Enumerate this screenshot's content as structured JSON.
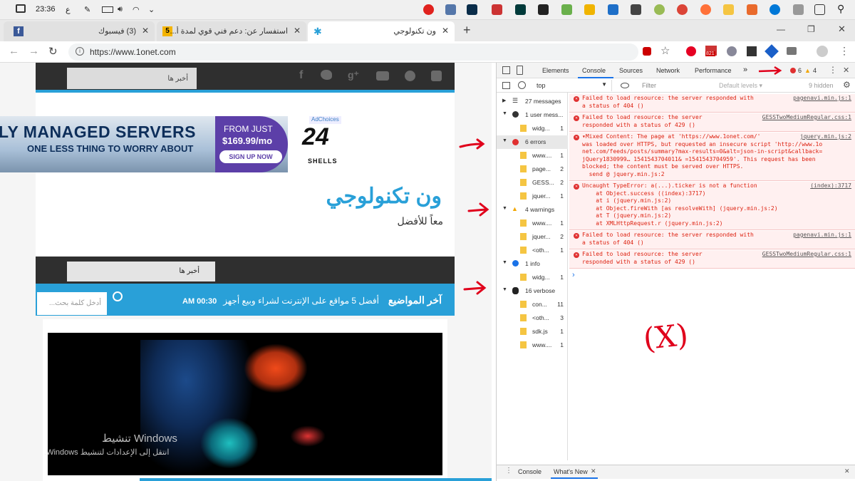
{
  "taskbar": {
    "time": "23:36",
    "lang": "ع"
  },
  "tabs": [
    {
      "title": "(3) فيسبوك",
      "icon": "facebook-icon"
    },
    {
      "title": "استفسار عن: دعم فني قوي لمدة أ...",
      "icon": "forum-icon"
    },
    {
      "title": "ون تكنولوجي",
      "icon": "site-icon"
    }
  ],
  "address": {
    "url": "https://www.1onet.com",
    "ext_badge": "821"
  },
  "site": {
    "search_placeholder_top": "أخبر ها",
    "ad": {
      "headline": "LY MANAGED SERVERS",
      "subline": "ONE LESS THING TO WORRY ABOUT",
      "from": "FROM JUST",
      "price": "$169.99/mo",
      "cta": "SIGN UP NOW",
      "adchoices": "AdChoices",
      "brand_num": "24",
      "brand_name": "SHELLS"
    },
    "title": "ون تكنولوجي",
    "tagline": "معاً للأفضل",
    "search_placeholder_mid": "أخبر ها",
    "ticker_label": "آخر المواضيع",
    "ticker_text": "أفضل 5 مواقع على الإنترنت لشراء وبيع أجهز",
    "ticker_time": "AM 00:30",
    "search_input": "أدخل كلمة بحث...",
    "watermark1": "تنشيط Windows",
    "watermark2": "انتقل إلى الإعدادات لتنشيط Windows."
  },
  "devtools": {
    "tabs": [
      "Elements",
      "Console",
      "Sources",
      "Network",
      "Performance",
      "»"
    ],
    "error_count": "6",
    "warning_count": "4",
    "context": "top",
    "filter_placeholder": "Filter",
    "levels": "Default levels ▾",
    "hidden": "9 hidden",
    "sidebar": [
      {
        "label": "27 messages",
        "count": "",
        "kind": "list"
      },
      {
        "label": "1 user mess...",
        "count": "",
        "kind": "user"
      },
      {
        "label": "widg...",
        "count": "1",
        "kind": "file"
      },
      {
        "label": "6 errors",
        "count": "",
        "kind": "error"
      },
      {
        "label": "www....",
        "count": "1",
        "kind": "file"
      },
      {
        "label": "page...",
        "count": "2",
        "kind": "file"
      },
      {
        "label": "GESS...",
        "count": "2",
        "kind": "file"
      },
      {
        "label": "jquer...",
        "count": "1",
        "kind": "file"
      },
      {
        "label": "4 warnings",
        "count": "",
        "kind": "warning"
      },
      {
        "label": "www....",
        "count": "1",
        "kind": "file"
      },
      {
        "label": "jquer...",
        "count": "2",
        "kind": "file"
      },
      {
        "label": "<oth...",
        "count": "1",
        "kind": "file"
      },
      {
        "label": "1 info",
        "count": "",
        "kind": "info"
      },
      {
        "label": "widg...",
        "count": "1",
        "kind": "file"
      },
      {
        "label": "16 verbose",
        "count": "",
        "kind": "verbose"
      },
      {
        "label": "con...",
        "count": "11",
        "kind": "file"
      },
      {
        "label": "<oth...",
        "count": "3",
        "kind": "file"
      },
      {
        "label": "sdk.js",
        "count": "1",
        "kind": "file"
      },
      {
        "label": "www....",
        "count": "1",
        "kind": "file"
      }
    ],
    "messages": [
      {
        "text": "Failed to load resource: the server responded with\na status of 404 ()",
        "src": "pagenavi.min.js:1",
        "lines": 2
      },
      {
        "text": "Failed to load resource: the server\nresponded with a status of 429 ()",
        "src": "GESSTwoMediumRegular.css:1",
        "lines": 2
      },
      {
        "text": "▾Mixed Content: The page at 'https://www.1onet.com/'\nwas loaded over HTTPS, but requested an insecure script 'http://www.1o\nnet.com/feeds/posts/summary?max-results=0&alt=json-in-script&callback=\njQuery1830999… 1541543704011& =1541543704959'. This request has been\nblocked; the content must be served over HTTPS.\n  send @ jquery.min.js:2",
        "src": "jquery.min.js:2",
        "lines": 6
      },
      {
        "text": "Uncaught TypeError: a(...).ticker is not a function\n    at Object.success ((index):3717)\n    at i (jquery.min.js:2)\n    at Object.fireWith [as resolveWith] (jquery.min.js:2)\n    at T (jquery.min.js:2)\n    at XMLHttpRequest.r (jquery.min.js:2)",
        "src": "(index):3717",
        "lines": 6
      },
      {
        "text": "Failed to load resource: the server responded with\na status of 404 ()",
        "src": "pagenavi.min.js:1",
        "lines": 2
      },
      {
        "text": "Failed to load resource: the server\nresponded with a status of 429 ()",
        "src": "GESSTwoMediumRegular.css:1",
        "lines": 2
      }
    ],
    "prompt": "›",
    "drawer_tabs": [
      "Console",
      "What's New"
    ],
    "annotation": "(X)"
  }
}
